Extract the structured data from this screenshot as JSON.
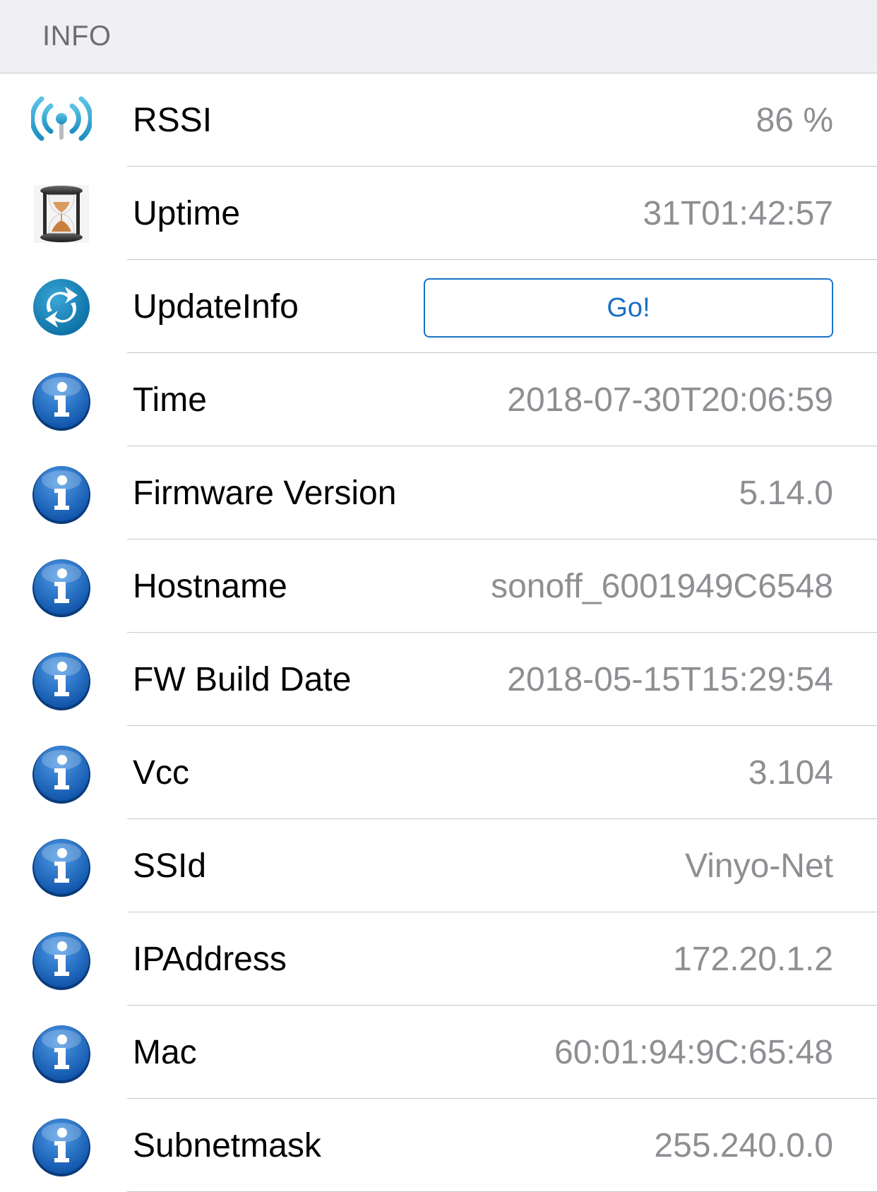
{
  "section": {
    "title": "INFO"
  },
  "rows": [
    {
      "icon": "wifi-signal-icon",
      "label": "RSSI",
      "value": "86 %"
    },
    {
      "icon": "hourglass-icon",
      "label": "Uptime",
      "value": "31T01:42:57"
    },
    {
      "icon": "refresh-icon",
      "label": "UpdateInfo",
      "button": "Go!"
    },
    {
      "icon": "info-icon",
      "label": "Time",
      "value": "2018-07-30T20:06:59"
    },
    {
      "icon": "info-icon",
      "label": "Firmware Version",
      "value": "5.14.0"
    },
    {
      "icon": "info-icon",
      "label": "Hostname",
      "value": "sonoff_6001949C6548"
    },
    {
      "icon": "info-icon",
      "label": "FW Build Date",
      "value": "2018-05-15T15:29:54"
    },
    {
      "icon": "info-icon",
      "label": "Vcc",
      "value": "3.104"
    },
    {
      "icon": "info-icon",
      "label": "SSId",
      "value": "Vinyo-Net"
    },
    {
      "icon": "info-icon",
      "label": "IPAddress",
      "value": "172.20.1.2"
    },
    {
      "icon": "info-icon",
      "label": "Mac",
      "value": "60:01:94:9C:65:48"
    },
    {
      "icon": "info-icon",
      "label": "Subnetmask",
      "value": "255.240.0.0"
    }
  ],
  "colors": {
    "accent": "#1a73c8",
    "value_text": "#8e8e93",
    "header_bg": "#efeff4",
    "separator": "#c8c7cc"
  }
}
